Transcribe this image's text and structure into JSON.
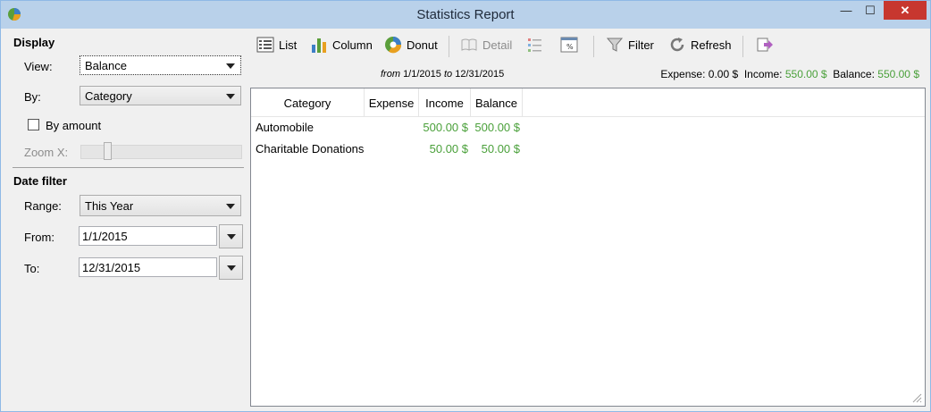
{
  "window": {
    "title": "Statistics Report",
    "min_glyph": "—",
    "max_glyph": "☐",
    "close_glyph": "✕"
  },
  "sidebar": {
    "display_title": "Display",
    "view_label": "View:",
    "view_value": "Balance",
    "by_label": "By:",
    "by_value": "Category",
    "by_amount_label": "By amount",
    "by_amount_checked": false,
    "zoom_label": "Zoom X:",
    "date_filter_title": "Date filter",
    "range_label": "Range:",
    "range_value": "This Year",
    "from_label": "From:",
    "from_value": "1/1/2015",
    "to_label": "To:",
    "to_value": "12/31/2015"
  },
  "toolbar": {
    "list": "List",
    "column": "Column",
    "donut": "Donut",
    "detail": "Detail",
    "filter": "Filter",
    "refresh": "Refresh"
  },
  "summary": {
    "from_word": "from",
    "from_date": "1/1/2015",
    "to_word": "to",
    "to_date": "12/31/2015",
    "expense_label": "Expense:",
    "expense_value": "0.00 $",
    "income_label": "Income:",
    "income_value": "550.00 $",
    "balance_label": "Balance:",
    "balance_value": "550.00 $"
  },
  "table": {
    "columns": [
      "Category",
      "Expense",
      "Income",
      "Balance"
    ],
    "rows": [
      {
        "category": "Automobile",
        "expense": "",
        "income": "500.00 $",
        "balance": "500.00 $"
      },
      {
        "category": "Charitable Donations",
        "expense": "",
        "income": "50.00 $",
        "balance": "50.00 $"
      }
    ]
  },
  "colors": {
    "positive": "#4aa03a",
    "title_bar": "#b9d1ea",
    "close_button": "#c7372f"
  }
}
